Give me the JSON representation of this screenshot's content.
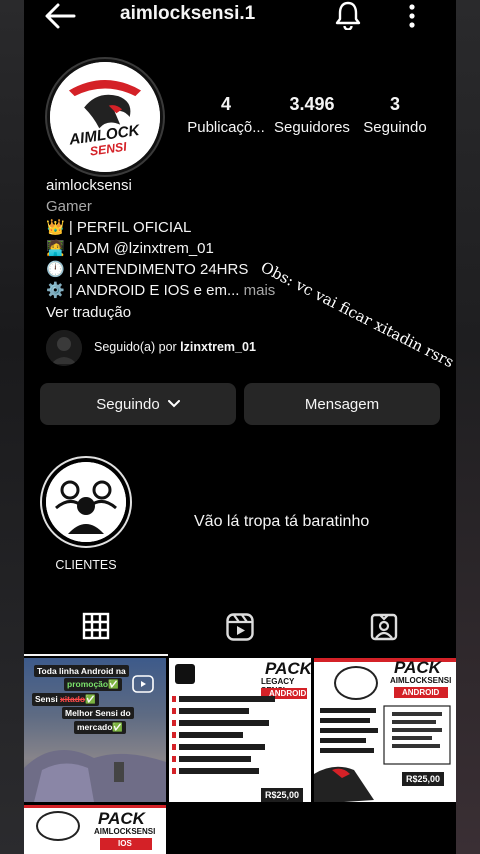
{
  "topbar": {
    "username": "aimlocksensi.1",
    "icons": [
      "back-arrow-icon",
      "bell-icon",
      "more-vertical-icon"
    ]
  },
  "stats": {
    "posts": {
      "value": "4",
      "label": "Publicaçõ..."
    },
    "followers": {
      "value": "3.496",
      "label": "Seguidores"
    },
    "following": {
      "value": "3",
      "label": "Seguindo"
    }
  },
  "avatar": {
    "logo_line1": "AIMLOCK",
    "logo_line2": "SENSI"
  },
  "bio": {
    "name": "aimlocksensi",
    "category": "Gamer",
    "lines": [
      "👑 | PERFIL OFICIAL",
      "🧑‍💻 | ADM @lzinxtrem_01",
      "🕛 | ANTENDIMENTO 24HRS",
      "⚙️ | ANDROID E IOS e em..."
    ],
    "more": "mais",
    "translate": "Ver tradução"
  },
  "overlay_note": "Obs: vc vai ficar xitadin rsrs",
  "followed_by": {
    "prefix": "Seguido(a) por ",
    "user": "lzinxtrem_01"
  },
  "buttons": {
    "following": "Seguindo",
    "message": "Mensagem"
  },
  "highlight": {
    "label": "CLIENTES"
  },
  "promo_text": "Vão lá tropa tá baratinho",
  "tabs": [
    {
      "name": "grid",
      "icon": "grid-icon",
      "active": true
    },
    {
      "name": "reels",
      "icon": "reels-icon",
      "active": false
    },
    {
      "name": "tagged",
      "icon": "tagged-icon",
      "active": false
    }
  ],
  "posts": {
    "p1": {
      "line1": "Toda linha Android na",
      "line2": "promoção✅",
      "line3": "Sensi ",
      "line3b": "✅",
      "line4": "Melhor Sensi do",
      "line5": "mercado✅"
    },
    "p2": {
      "title": "PACK",
      "subtitle": "LEGACY SENSI",
      "platform": "ANDROID",
      "price": "R$25,00"
    },
    "p3": {
      "title": "PACK",
      "subtitle": "AIMLOCKSENSI",
      "platform": "ANDROID",
      "price": "R$25,00"
    },
    "p4": {
      "title": "PACK",
      "subtitle": "AIMLOCKSENSI",
      "platform": "IOS"
    }
  },
  "colors": {
    "background": "#000000",
    "button": "#262626",
    "secondary_text": "#a8a8a8",
    "brand_red": "#d42127"
  }
}
